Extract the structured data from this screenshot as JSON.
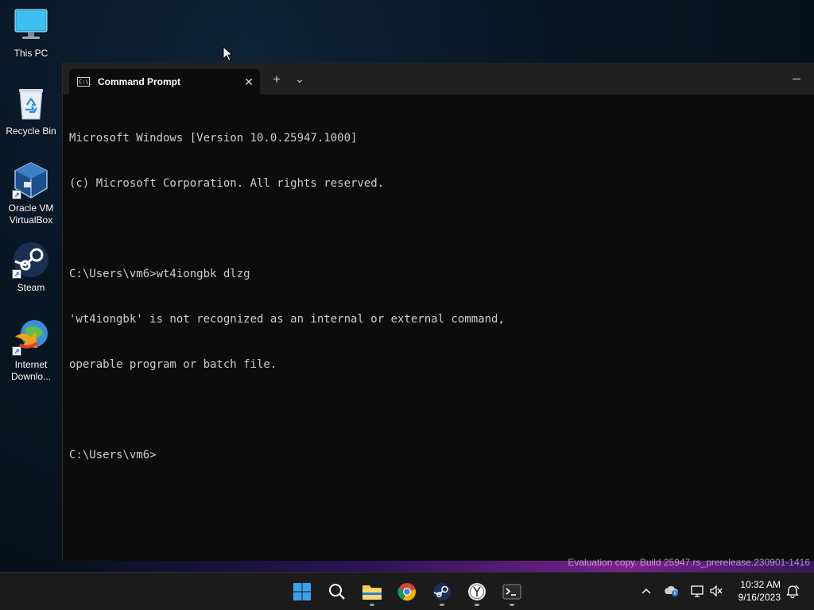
{
  "desktop": {
    "icons": [
      {
        "label": "This PC"
      },
      {
        "label": "Recycle Bin"
      },
      {
        "label": "Oracle VM VirtualBox"
      },
      {
        "label": "Steam"
      },
      {
        "label": "Internet Downlo..."
      }
    ]
  },
  "terminal": {
    "tab_title": "Command Prompt",
    "new_tab_glyph": "+",
    "dropdown_glyph": "⌄",
    "close_glyph": "✕",
    "tab_icon_text": "C:\\_",
    "lines": [
      "Microsoft Windows [Version 10.0.25947.1000]",
      "(c) Microsoft Corporation. All rights reserved.",
      "",
      "C:\\Users\\vm6>wt4iongbk dlzg",
      "'wt4iongbk' is not recognized as an internal or external command,",
      "operable program or batch file.",
      "",
      "C:\\Users\\vm6>"
    ]
  },
  "watermark": "Evaluation copy. Build 25947.rs_prerelease.230901-1416",
  "taskbar": {
    "apps": [
      "start-icon",
      "search-icon",
      "file-explorer-icon",
      "chrome-icon",
      "steam-icon",
      "clock-app-icon",
      "terminal-icon"
    ],
    "tray": [
      "chevron-up-icon",
      "onedrive-icon",
      "network-icon",
      "volume-muted-icon",
      "notification-icon"
    ],
    "time": "10:32 AM",
    "date": "9/16/2023"
  },
  "colors": {
    "console_bg": "#0c0c0c",
    "console_text": "#cccccc",
    "titlebar_bg": "#202020",
    "taskbar_bg": "#1b1b1b"
  }
}
